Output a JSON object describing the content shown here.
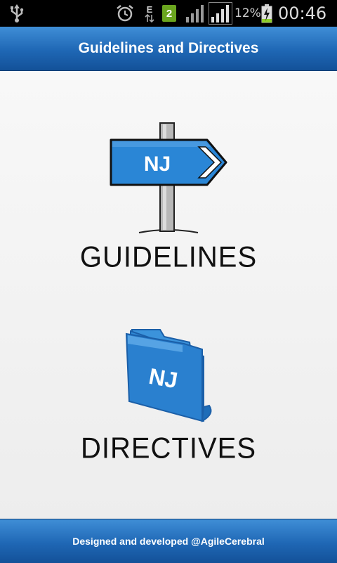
{
  "status_bar": {
    "network_type": "E",
    "sim_badge": "2",
    "battery_percent": "12%",
    "time": "00:46",
    "icons": [
      "usb-icon",
      "alarm-icon",
      "data-arrows-icon",
      "sim-icon",
      "signal-icon",
      "signal-icon",
      "battery-charging-icon"
    ]
  },
  "header": {
    "title": "Guidelines and Directives"
  },
  "main": {
    "guidelines": {
      "label": "GUIDELINES",
      "sign_text": "NJ",
      "icon": "signpost-icon"
    },
    "directives": {
      "label": "DIRECTIVES",
      "folder_text": "NJ",
      "icon": "folder-icon"
    }
  },
  "footer": {
    "credit": "Designed and developed @AgileCerebral"
  },
  "colors": {
    "bar_blue": "#1f67b5",
    "icon_blue": "#2a86d6",
    "label_black": "#111111"
  }
}
